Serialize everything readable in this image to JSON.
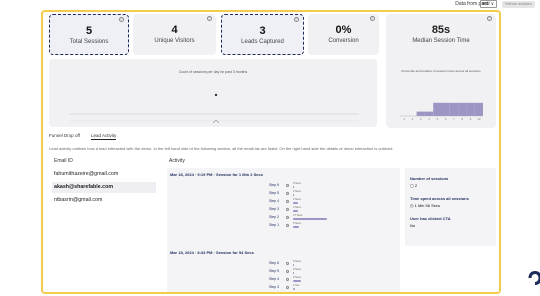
{
  "topbar": {
    "data_from_label": "Data from past",
    "range_value": "90d ∨",
    "refresh_label": "Refresh analytics"
  },
  "stats": [
    {
      "value": "5",
      "label": "Total Sessions"
    },
    {
      "value": "4",
      "label": "Unique Visitors"
    },
    {
      "value": "3",
      "label": "Leads Captured"
    },
    {
      "value": "0%",
      "label": "Conversion"
    }
  ],
  "median": {
    "value": "85s",
    "label": "Median Session Time",
    "caption": "Percentile and duration of session times across all sessions",
    "histogram": [
      0,
      0,
      0.2,
      0.2,
      0.6,
      0.6,
      0.6,
      0.6,
      0.6,
      0.6
    ],
    "ticks": [
      "1",
      "2",
      "3",
      "4",
      "5",
      "6",
      "7",
      "8",
      "9",
      "10"
    ]
  },
  "session_chart": {
    "caption": "Count of sessions per day for past 3 months"
  },
  "info_icon": "ⓘ",
  "tabs": [
    {
      "label": "Funnel Drop off"
    },
    {
      "label": "Lead Activity"
    }
  ],
  "lead_activity": {
    "description": "Lead activity outlines how a lead interacted with the demo. In the left hand side of the following section, all the email ids are listed. On the right hand side the details of demo interaction is outlined.",
    "email_header": "Email ID",
    "activity_header": "Activity",
    "emails": [
      "fahumithazeire@gmail.com",
      "akash@sharefable.com",
      "ntbasrin@gmail.com"
    ],
    "sessions": [
      {
        "title": "Mar 18, 2024 · 9:19 PM  ·  Session for 1 Min 2 Secs",
        "steps": [
          {
            "label": "Step 6",
            "dur": "0 Secs",
            "frac": 0
          },
          {
            "label": "Step 5",
            "dur": "0 Secs",
            "frac": 0
          },
          {
            "label": "Step 4",
            "dur": "4 Secs",
            "frac": 0.06
          },
          {
            "label": "Step 3",
            "dur": "4 Secs",
            "frac": 0.06
          },
          {
            "label": "Step 2",
            "dur": "27 Secs",
            "frac": 0.42
          },
          {
            "label": "Step 1",
            "dur": "5 Secs",
            "frac": 0.08
          }
        ]
      },
      {
        "title": "Mar 18, 2024 · 8:33 PM  ·  Session for 54 Secs",
        "steps": [
          {
            "label": "Step 6",
            "dur": "0 Secs",
            "frac": 0
          },
          {
            "label": "Step 5",
            "dur": "0 Secs",
            "frac": 0
          },
          {
            "label": "Step 4",
            "dur": "6 Secs",
            "frac": 0.1
          },
          {
            "label": "Step 3",
            "dur": "1 Sec",
            "frac": 0.02
          }
        ]
      }
    ],
    "summary": {
      "sessions_label": "Number of sessions",
      "sessions_value": "2",
      "time_label": "Time spent across all sessions",
      "time_value": "1 Min 56 Secs",
      "cta_label": "User has clicked CTA",
      "cta_value": "No"
    }
  }
}
